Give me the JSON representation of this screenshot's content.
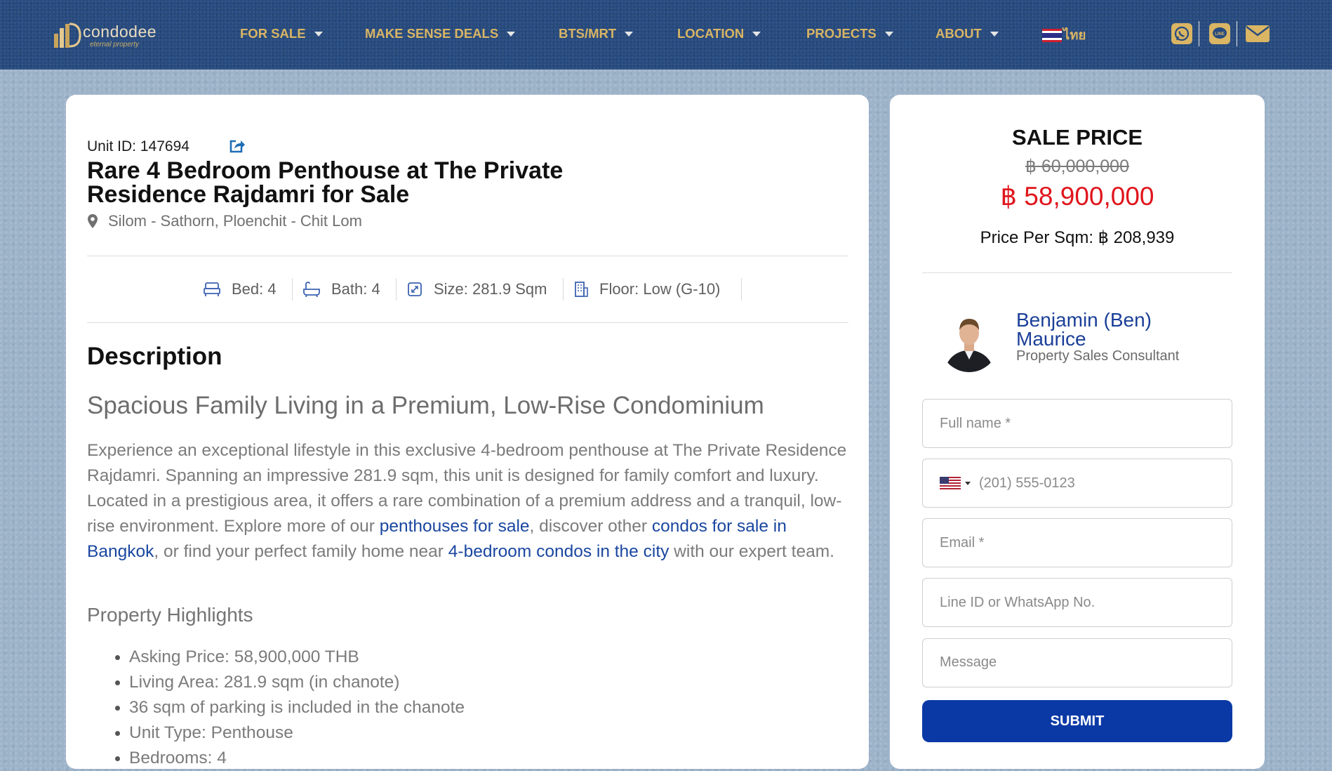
{
  "header": {
    "logo": {
      "name": "condodee",
      "tagline": "eternal property"
    },
    "nav": [
      {
        "label": "FOR SALE"
      },
      {
        "label": "MAKE SENSE DEALS"
      },
      {
        "label": "BTS/MRT"
      },
      {
        "label": "LOCATION"
      },
      {
        "label": "PROJECTS"
      },
      {
        "label": "ABOUT"
      }
    ],
    "language": {
      "label": "ไทย",
      "flag_icon": "thailand-flag-icon"
    },
    "social": [
      "whatsapp-icon",
      "line-icon",
      "email-icon"
    ]
  },
  "listing": {
    "unit_id": "Unit ID: 147694",
    "title": "Rare 4 Bedroom Penthouse at The Private Residence Rajdamri for Sale",
    "location": "Silom - Sathorn, Ploenchit - Chit Lom",
    "specs": {
      "bed": "Bed: 4",
      "bath": "Bath: 4",
      "size": "Size: 281.9 Sqm",
      "floor": "Floor: Low (G-10)"
    },
    "description_heading": "Description",
    "subheading": "Spacious Family Living in a Premium, Low-Rise Condominium",
    "paragraph": {
      "part1": "Experience an exceptional lifestyle in this exclusive 4-bedroom penthouse at The Private Residence Rajdamri. Spanning an impressive 281.9 sqm, this unit is designed for family comfort and luxury. Located in a prestigious area, it offers a rare combination of a premium address and a tranquil, low-rise environment. Explore more of our ",
      "link1": "penthouses for sale",
      "part2": ", discover other ",
      "link2": "condos for sale in Bangkok",
      "part3": ", or find your perfect family home near ",
      "link3": "4-bedroom condos in the city",
      "part4": " with our expert team."
    },
    "highlights_heading": "Property Highlights",
    "highlights": [
      "Asking Price: 58,900,000 THB",
      "Living Area: 281.9 sqm (in chanote)",
      "36 sqm of parking is included in the chanote",
      "Unit Type: Penthouse",
      "Bedrooms: 4"
    ]
  },
  "sidebar": {
    "sale_label": "SALE PRICE",
    "old_price": "฿ 60,000,000",
    "new_price": "฿ 58,900,000",
    "price_per_sqm": "Price Per Sqm: ฿ 208,939",
    "agent": {
      "name": "Benjamin (Ben) Maurice",
      "role": "Property Sales Consultant"
    },
    "form": {
      "full_name_placeholder": "Full name *",
      "phone_placeholder": "(201) 555-0123",
      "email_placeholder": "Email *",
      "line_placeholder": "Line ID or WhatsApp No.",
      "message_placeholder": "Message",
      "submit_label": "SUBMIT"
    }
  },
  "colors": {
    "header_bg": "#274a7e",
    "nav_gold": "#d9b564",
    "price_red": "#e0141c",
    "link_blue": "#1a47a0",
    "submit_blue": "#0a39a6"
  }
}
